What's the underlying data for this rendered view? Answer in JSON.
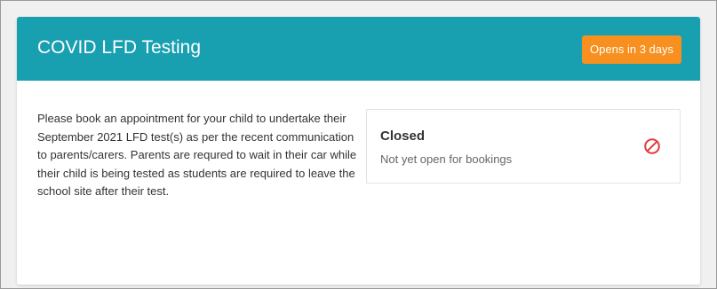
{
  "card": {
    "title": "COVID LFD Testing",
    "badge": "Opens in 3 days",
    "description": "Please book an appointment for your child to undertake their September 2021 LFD test(s) as per the recent communication to parents/carers. Parents are requred to wait in their car while their child is being tested as students are required to leave the school site after their test."
  },
  "booking": {
    "status": "Closed",
    "note": "Not yet open for bookings",
    "icon": "prohibited-icon"
  },
  "colors": {
    "header": "#189fb0",
    "badge": "#f7901e",
    "closed_icon": "#e23b3b"
  }
}
